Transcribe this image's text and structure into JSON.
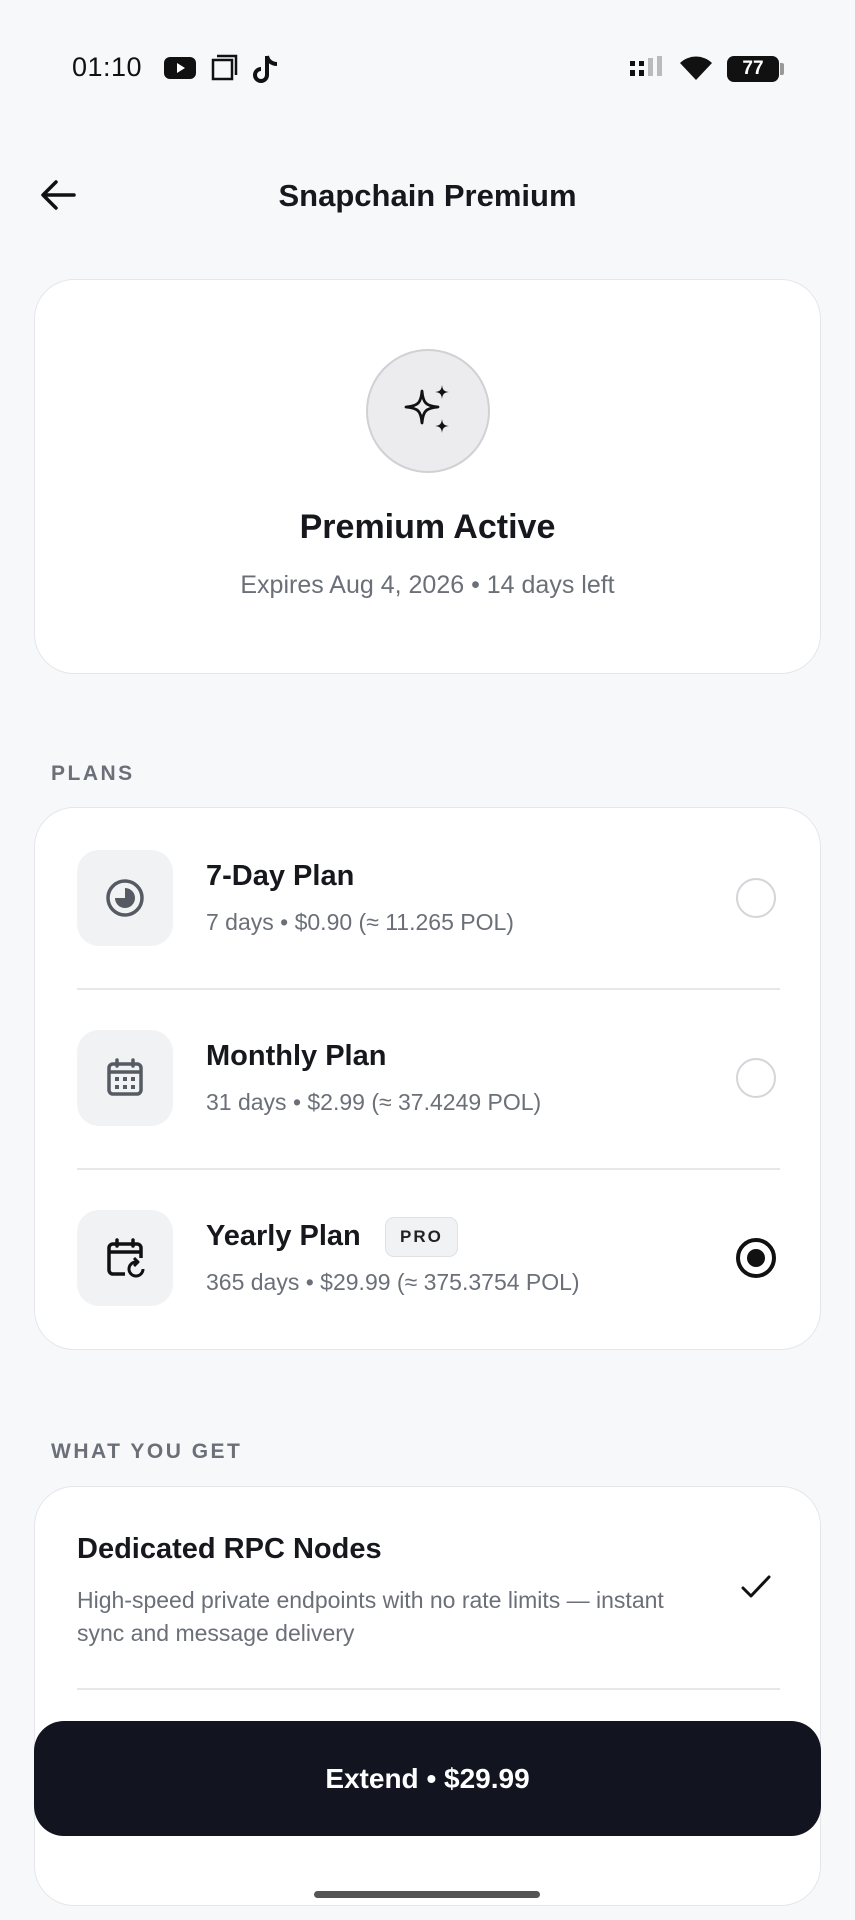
{
  "status_bar": {
    "time": "01:10",
    "battery": "77",
    "notification_icons": [
      "youtube-icon",
      "screen-icon",
      "tiktok-icon"
    ],
    "system_icons": [
      "signal-icon",
      "wifi-icon",
      "battery-icon"
    ]
  },
  "header": {
    "title": "Snapchain Premium",
    "back_icon": "arrow-left-icon"
  },
  "status_card": {
    "icon": "sparkles-icon",
    "title": "Premium Active",
    "subtitle": "Expires Aug 4, 2026 • 14 days left"
  },
  "plans": {
    "section_label": "PLANS",
    "items": [
      {
        "name": "7-Day Plan",
        "details": "7 days • $0.90 (≈ 11.265 POL)",
        "icon": "clock-icon",
        "selected": false
      },
      {
        "name": "Monthly Plan",
        "details": "31 days • $2.99 (≈ 37.4249 POL)",
        "icon": "calendar-icon",
        "selected": false
      },
      {
        "name": "Yearly Plan",
        "badge": "PRO",
        "details": "365 days • $29.99 (≈ 375.3754 POL)",
        "icon": "calendar-repeat-icon",
        "selected": true
      }
    ]
  },
  "benefits": {
    "section_label": "WHAT YOU GET",
    "items": [
      {
        "title": "Dedicated RPC Nodes",
        "description": "High-speed private endpoints with no rate limits — instant sync and message delivery",
        "icon": "check-icon"
      }
    ]
  },
  "cta": {
    "label": "Extend • $29.99"
  },
  "colors": {
    "background": "#f7f8fa",
    "cta": "#12151f",
    "muted_text": "#6b6f78"
  }
}
